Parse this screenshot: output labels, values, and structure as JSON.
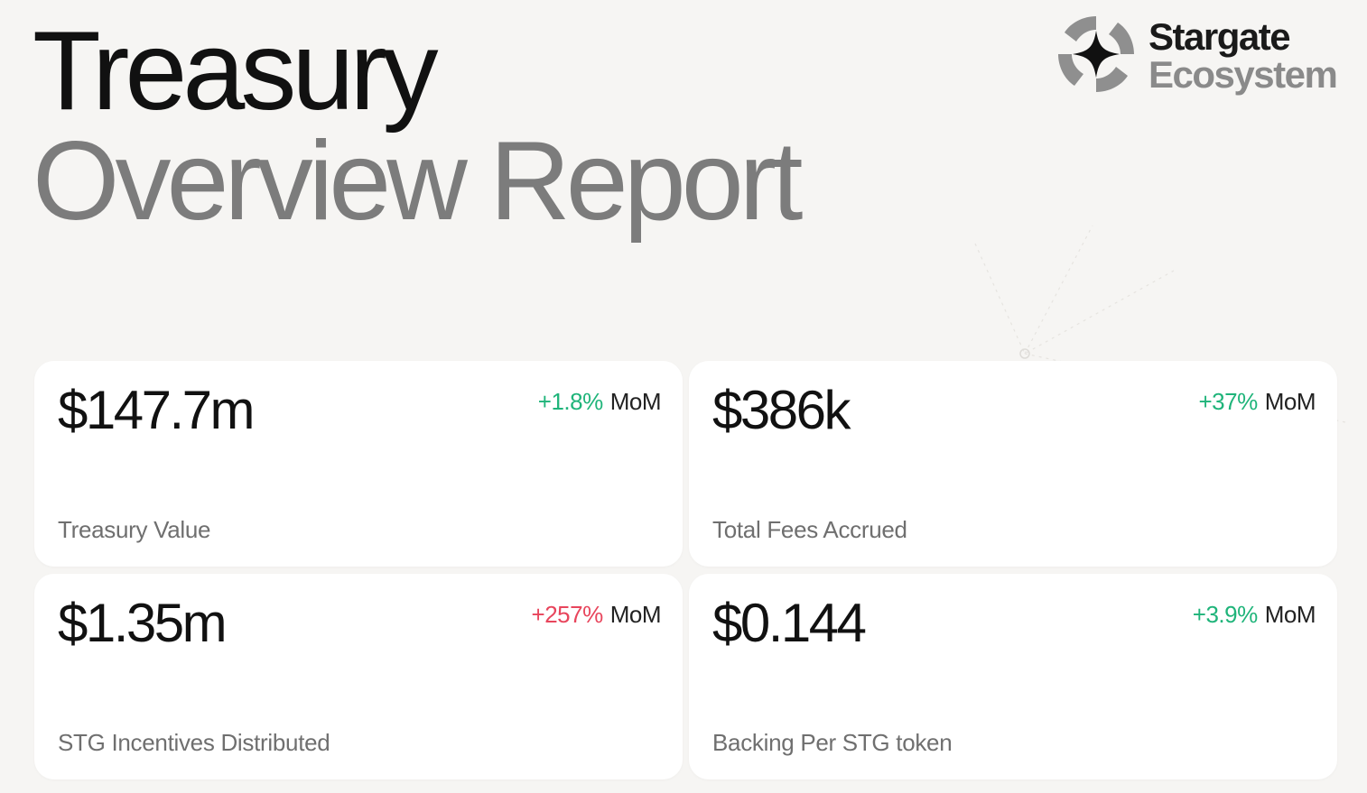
{
  "header": {
    "title_line1": "Treasury",
    "title_line2": "Overview Report"
  },
  "brand": {
    "logo_icon": "stargate-star-icon",
    "name_line1": "Stargate",
    "name_line2": "Ecosystem"
  },
  "colors": {
    "background": "#f6f5f3",
    "card": "#ffffff",
    "positive": "#1fb47a",
    "negative": "#e8455c",
    "title_dark": "#111111",
    "title_gray": "#7c7c7c"
  },
  "metrics": [
    {
      "value": "$147.7m",
      "change": "+1.8%",
      "change_unit": "MoM",
      "trend": "positive",
      "label": "Treasury Value"
    },
    {
      "value": "$386k",
      "change": "+37%",
      "change_unit": "MoM",
      "trend": "positive",
      "label": "Total Fees Accrued"
    },
    {
      "value": "$1.35m",
      "change": "+257%",
      "change_unit": "MoM",
      "trend": "negative",
      "label": "STG Incentives Distributed"
    },
    {
      "value": "$0.144",
      "change": "+3.9%",
      "change_unit": "MoM",
      "trend": "positive",
      "label": "Backing Per STG token"
    }
  ]
}
